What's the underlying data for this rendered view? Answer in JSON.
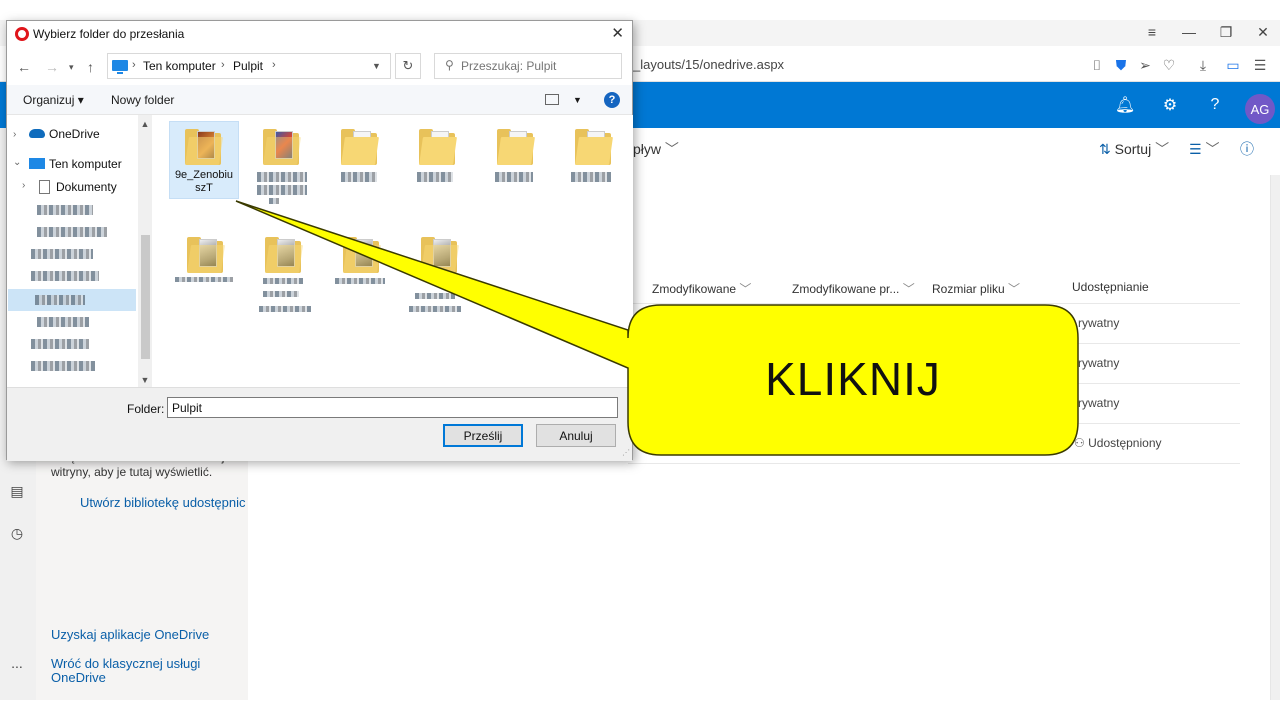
{
  "browser": {
    "url": "_layouts/15/onedrive.aspx",
    "icons": [
      "camera-icon",
      "shield-icon",
      "send-icon",
      "heart-icon",
      "download-icon",
      "battery-icon",
      "menu-icon"
    ]
  },
  "onedrive": {
    "avatar": "AG",
    "cmd_partial": "pływ",
    "sort": "Sortuj",
    "columns": [
      "Zmodyfikowane",
      "Zmodyfikowane pr...",
      "Rozmiar pliku",
      "Udostępnianie"
    ],
    "sharing": [
      "rywatny",
      "rywatny",
      "rywatny",
      "Udostępniony"
    ],
    "nav_text": "urządzenia. Utwórz lub obserwuj witryny, aby je tutaj wyświetlić.",
    "nav_create": "Utwórz bibliotekę udostępnic",
    "get_apps": "Uzyskaj aplikacje OneDrive",
    "classic": "Wróć do klasycznej usługi OneDrive",
    "more": "..."
  },
  "dialog": {
    "title": "Wybierz folder do przesłania",
    "breadcrumb": [
      "Ten komputer",
      "Pulpit"
    ],
    "search_placeholder": "Przeszukaj: Pulpit",
    "organize": "Organizuj ▾",
    "new_folder": "Nowy folder",
    "help": "?",
    "tree": {
      "onedrive": "OneDrive",
      "this_pc": "Ten komputer",
      "documents": "Dokumenty"
    },
    "selected_file": "9e_Zenobiu szT",
    "folder_label": "Folder:",
    "folder_value": "Pulpit",
    "upload_btn": "Prześlij",
    "cancel_btn": "Anuluj"
  },
  "callout": {
    "text": "KLIKNIJ",
    "fill": "#ffff00",
    "stroke": "#3a3a00"
  }
}
